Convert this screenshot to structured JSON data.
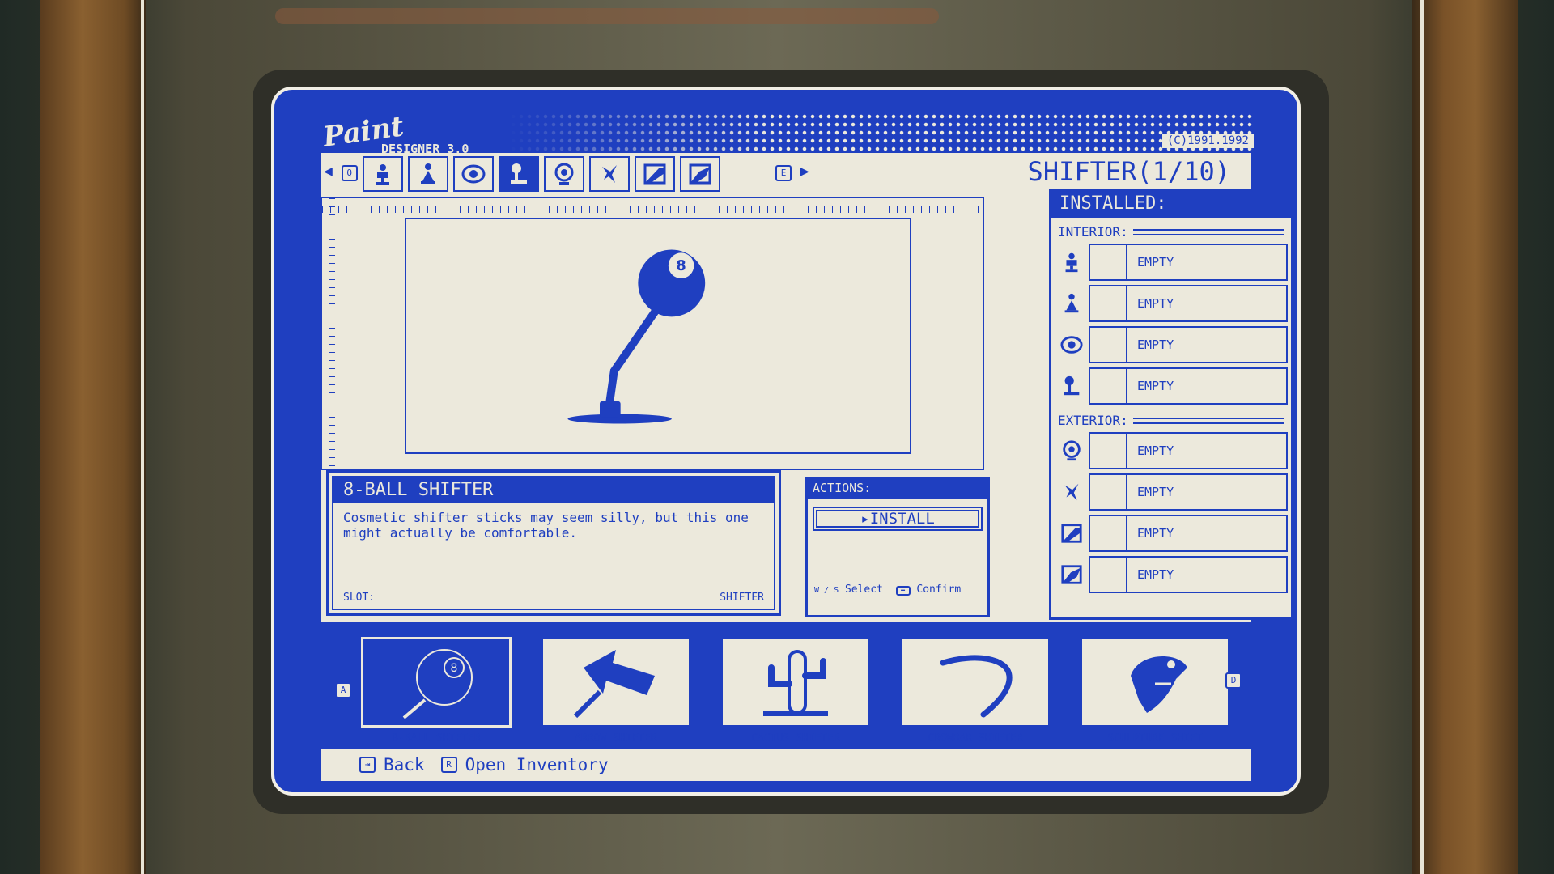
{
  "app": {
    "logo_script": "Paint",
    "logo_sub": "DESIGNER 3.0",
    "copyright": "(C)1991.1992"
  },
  "toolbar": {
    "prev_key": "Q",
    "next_key": "E",
    "tools": [
      {
        "icon": "seat-icon",
        "active": false
      },
      {
        "icon": "bobblehead-icon",
        "active": false
      },
      {
        "icon": "eye-icon",
        "active": false
      },
      {
        "icon": "shifter-icon",
        "active": true
      },
      {
        "icon": "steering-wheel-icon",
        "active": false
      },
      {
        "icon": "hood-ornament-icon",
        "active": false
      },
      {
        "icon": "door-panel-icon",
        "active": false
      },
      {
        "icon": "door-panel-alt-icon",
        "active": false
      }
    ]
  },
  "section": {
    "title": "SHIFTER(1/10)"
  },
  "installed": {
    "title": "INSTALLED:",
    "interior_label": "INTERIOR:",
    "exterior_label": "EXTERIOR:",
    "interior": [
      {
        "icon": "seat-icon",
        "value": "EMPTY"
      },
      {
        "icon": "bobblehead-icon",
        "value": "EMPTY"
      },
      {
        "icon": "eye-icon",
        "value": "EMPTY"
      },
      {
        "icon": "shifter-icon",
        "value": "EMPTY"
      }
    ],
    "exterior": [
      {
        "icon": "steering-wheel-icon",
        "value": "EMPTY"
      },
      {
        "icon": "hood-ornament-icon",
        "value": "EMPTY"
      },
      {
        "icon": "door-panel-icon",
        "value": "EMPTY"
      },
      {
        "icon": "door-panel-alt-icon",
        "value": "EMPTY"
      }
    ]
  },
  "item": {
    "name": "8-BALL SHIFTER",
    "description": "Cosmetic shifter sticks may seem silly, but this one might actually be comfortable.",
    "slot_label": "SLOT:",
    "slot_value": "SHIFTER"
  },
  "actions": {
    "title": "ACTIONS:",
    "install": "INSTALL",
    "select_keys": "W / S",
    "select_label": "Select",
    "confirm_label": "Confirm"
  },
  "tray": {
    "prev_key": "A",
    "next_key": "D",
    "items": [
      {
        "label": "8-BALL SHIFTER",
        "icon": "8-ball-icon",
        "active": true
      },
      {
        "label": "ARROW SHIFTER",
        "icon": "arrow-icon",
        "active": false
      },
      {
        "label": "CACTUS SHIFTER",
        "icon": "cactus-icon",
        "active": false
      },
      {
        "label": "CROWBAR SHIFTER",
        "icon": "crowbar-icon",
        "active": false
      },
      {
        "label": "SCULPTURE SHIFT",
        "icon": "sculpture-icon",
        "active": false
      }
    ]
  },
  "footer": {
    "back_key": "⇥",
    "back_label": "Back",
    "inventory_key": "R",
    "inventory_label": "Open Inventory"
  },
  "colors": {
    "screen_blue": "#1f3fc0",
    "screen_cream": "#ece9dc"
  }
}
